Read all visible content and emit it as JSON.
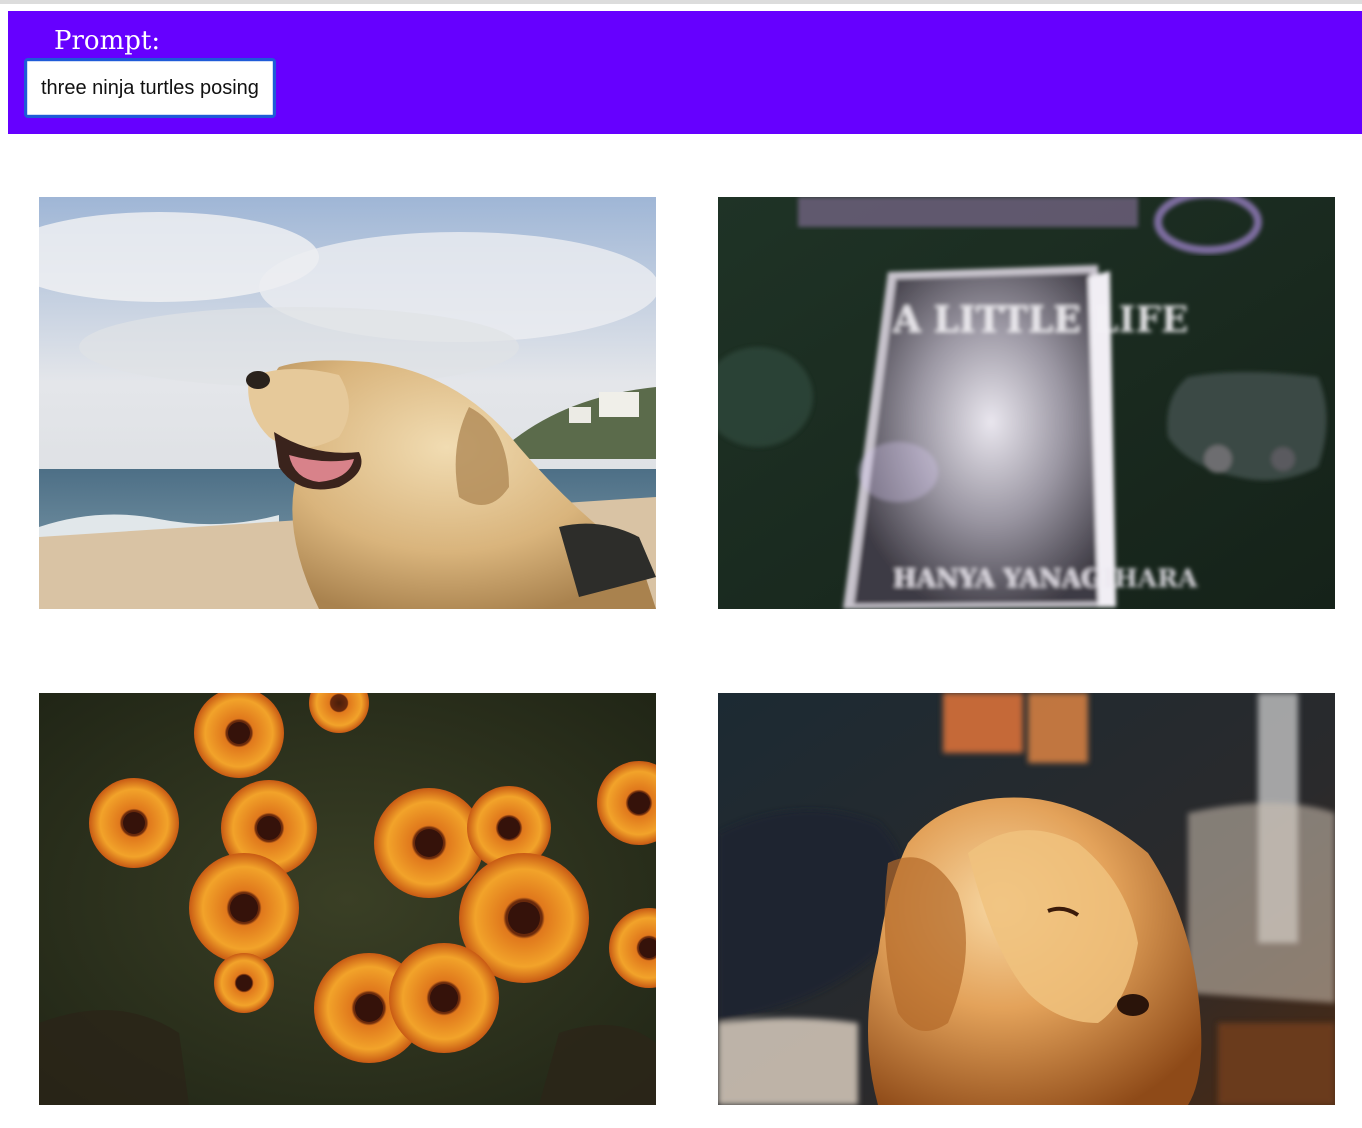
{
  "prompt": {
    "label": "Prompt:",
    "value": "three ninja turtles posing",
    "visible_value": "nree ninja turtles posing"
  },
  "gallery": {
    "images": [
      {
        "name": "dog-on-beach",
        "book_title": "",
        "author": ""
      },
      {
        "name": "blurry-book-cover",
        "book_title": "A LITTLE LIFE",
        "author": "HANYA YANAGIHARA"
      },
      {
        "name": "orange-daisies",
        "book_title": "",
        "author": ""
      },
      {
        "name": "golden-dog-warm-light",
        "book_title": "",
        "author": ""
      }
    ]
  },
  "colors": {
    "header_bg": "#6600ff",
    "input_border": "#1e5bd8"
  }
}
